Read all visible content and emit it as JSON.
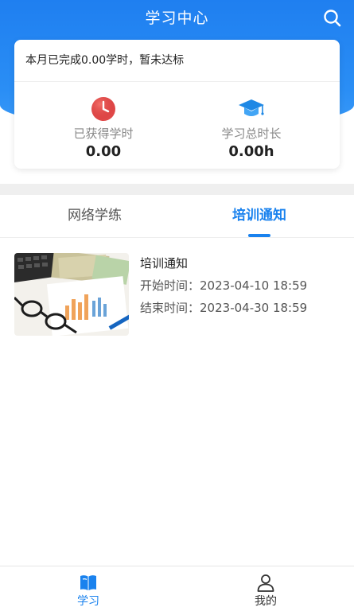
{
  "header": {
    "title": "学习中心"
  },
  "summary": {
    "notice": "本月已完成0.00学时，暂未达标",
    "stats": [
      {
        "label": "已获得学时",
        "value": "0.00"
      },
      {
        "label": "学习总时长",
        "value": "0.00h"
      }
    ]
  },
  "tabs": [
    {
      "label": "网络学练",
      "active": false
    },
    {
      "label": "培训通知",
      "active": true
    }
  ],
  "list": [
    {
      "title": "培训通知",
      "start_label": "开始时间：",
      "start": "2023-04-10 18:59",
      "end_label": "结束时间：",
      "end": "2023-04-30 18:59"
    }
  ],
  "bottom_nav": [
    {
      "label": "学习",
      "icon": "book-icon",
      "active": true
    },
    {
      "label": "我的",
      "icon": "user-icon",
      "active": false
    }
  ],
  "colors": {
    "primary": "#1a82ee",
    "clock": "#e04848"
  }
}
